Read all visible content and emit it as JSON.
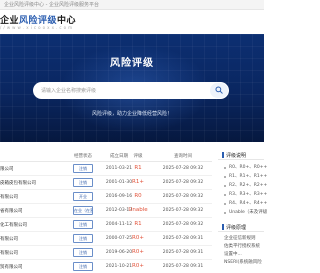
{
  "topbar": {
    "text": "企业风险评级中心 - 企业风险评级服务平台"
  },
  "header": {
    "title_prefix": "企业",
    "title_accent": "风险评级",
    "title_suffix": "中心",
    "url": "/ / w w w . x i c o o x x . c o m"
  },
  "hero": {
    "title": "风险评级",
    "search_placeholder": "请输入企业名称搜索评级",
    "subtitle": "风险评级，助力企业降低经营风险！"
  },
  "table": {
    "headers": [
      "",
      "经营状态",
      "成立日期",
      "评级",
      "查询时间"
    ],
    "rows": [
      {
        "name": "限公司",
        "status": "注销",
        "date": "2011-03-21",
        "rating": "R1",
        "query_time": "2025-07-28 09:32"
      },
      {
        "name": "皮箱皮包有限公司",
        "status": "注销",
        "date": "2001-01-30",
        "rating": "R1+",
        "query_time": "2025-07-28 09:32"
      },
      {
        "name": "有限公司",
        "status": "开业",
        "date": "2016-09-16",
        "rating": "R0",
        "query_time": "2025-07-28 09:32"
      },
      {
        "name": "省有限公司",
        "status": "在业（在营业）",
        "date": "2012-03-13",
        "rating": "Unable",
        "query_time": "2025-07-28 09:32"
      },
      {
        "name": "化工有限公司",
        "status": "注销",
        "date": "2004-11-12",
        "rating": "R1",
        "query_time": "2025-07-28 09:32"
      },
      {
        "name": "有限公司",
        "status": "注销",
        "date": "2000-07-25",
        "rating": "R0+",
        "query_time": "2025-07-28 09:31"
      },
      {
        "name": "有限公司",
        "status": "注销",
        "date": "2019-06-20",
        "rating": "R0+",
        "query_time": "2025-07-28 09:31"
      },
      {
        "name": "贸有限公司",
        "status": "注销",
        "date": "2021-10-21",
        "rating": "R0+",
        "query_time": "2025-07-28 09:31"
      }
    ]
  },
  "sidebar": {
    "section1": {
      "title": "评级说明",
      "items": [
        "R0、R0+、R0++",
        "R1、R1+、R1++",
        "R2、R2+、R2++",
        "R3、R3+、R3++",
        "R4、R4+、R4++",
        "Unable（未及评级"
      ]
    },
    "section2": {
      "title": "评级原理",
      "lines": [
        "企业征信新规则",
        "估类平行授权系统",
        "设置中...",
        "NSERI(系统融风险"
      ]
    }
  },
  "colors": {
    "hero_blue": "#0c2f72",
    "accent": "#2a5db0",
    "rating_red": "#e2533a"
  }
}
